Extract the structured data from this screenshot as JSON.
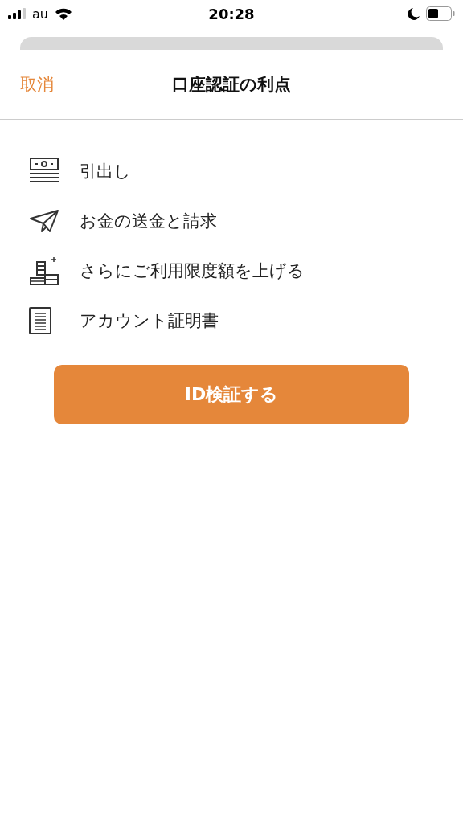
{
  "status_bar": {
    "carrier": "au",
    "time": "20:28"
  },
  "header": {
    "cancel": "取消",
    "title": "口座認証の利点"
  },
  "benefits": [
    {
      "kind": "cash",
      "label": "引出し"
    },
    {
      "kind": "send",
      "label": "お金の送金と請求"
    },
    {
      "kind": "limit",
      "label": "さらにご利用限度額を上げる"
    },
    {
      "kind": "document",
      "label": "アカウント証明書"
    }
  ],
  "button": "ID検証する"
}
